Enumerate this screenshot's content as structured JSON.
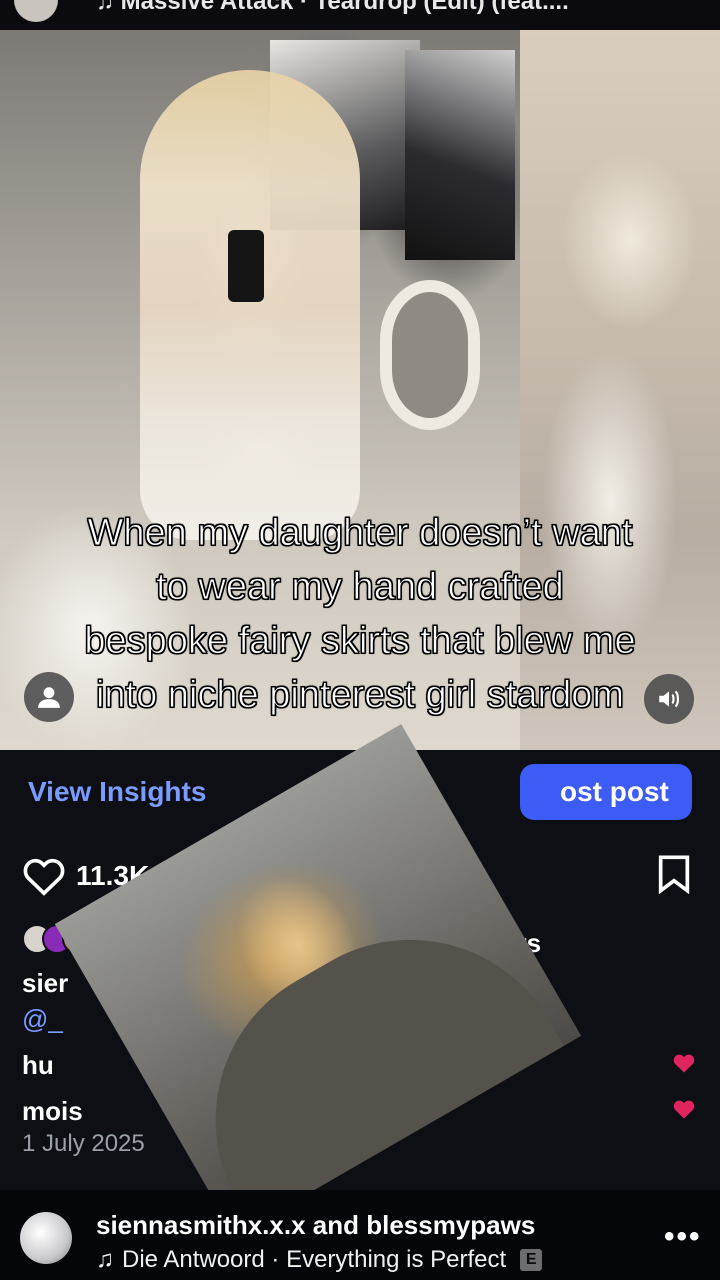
{
  "top_strip": {
    "song": "♫ Massive Attack · Teardrop (Edit) (feat...."
  },
  "overlay": {
    "text": "When my daughter doesn’t want to wear my hand crafted bespoke fairy skirts that blew me into niche pinterest girl stardom"
  },
  "post": {
    "insights_label": "View Insights",
    "boost_label": "ost post",
    "likes_count": "11.3K",
    "followers_word": "ers",
    "caption_user": "sier",
    "mention": "@_",
    "caption_line3": "hu",
    "caption_line4": "mois",
    "date": "1 July 2025"
  },
  "bottom": {
    "creators": "siennasmithx.x.x and blessmypaws",
    "music_note": "♫",
    "music": "Die Antwoord · Everything is Perfect",
    "explicit": "E",
    "more": "•••"
  },
  "icons": {
    "profile": "person-icon",
    "volume": "speaker-icon",
    "like": "heart-outline-icon",
    "save": "bookmark-icon",
    "liked_comment": "heart-filled-icon"
  },
  "colors": {
    "link": "#7b9bff",
    "boost": "#3d5cf5",
    "heart": "#e0245e"
  }
}
